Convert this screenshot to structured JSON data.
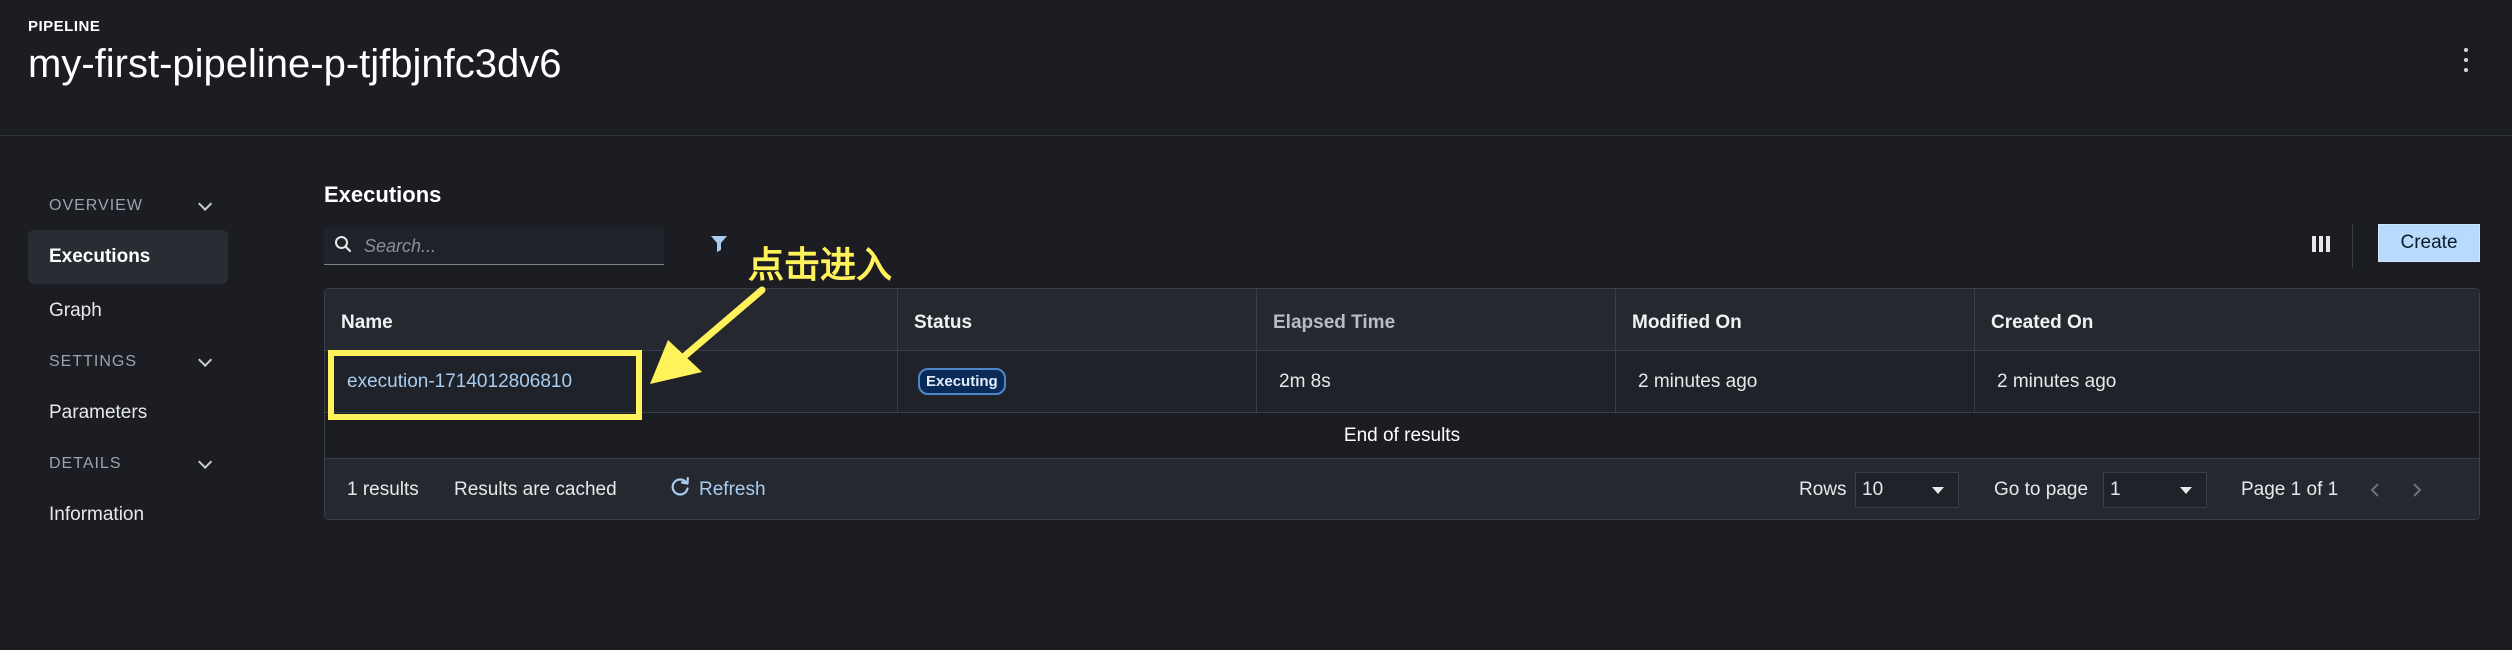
{
  "header": {
    "eyebrow": "PIPELINE",
    "title": "my-first-pipeline-p-tjfbjnfc3dv6",
    "menu_icon": "kebab-menu-icon"
  },
  "sidebar": {
    "items": [
      {
        "type": "section",
        "label": "OVERVIEW",
        "icon": "chevron-down-icon"
      },
      {
        "type": "item",
        "label": "Executions",
        "active": true
      },
      {
        "type": "item",
        "label": "Graph"
      },
      {
        "type": "section",
        "label": "SETTINGS",
        "icon": "chevron-down-icon"
      },
      {
        "type": "item",
        "label": "Parameters"
      },
      {
        "type": "section",
        "label": "DETAILS",
        "icon": "chevron-down-icon"
      },
      {
        "type": "item",
        "label": "Information"
      }
    ]
  },
  "main": {
    "section_title": "Executions",
    "search": {
      "placeholder": "Search...",
      "value": "",
      "icon": "search-icon"
    },
    "filter_icon": "filter-icon",
    "columns_icon": "columns-icon",
    "create_label": "Create",
    "table": {
      "columns": [
        "Name",
        "Status",
        "Elapsed Time",
        "Modified On",
        "Created On"
      ],
      "rows": [
        {
          "name": "execution-1714012806810",
          "status": "Executing",
          "elapsed": "2m 8s",
          "modified": "2 minutes ago",
          "created": "2 minutes ago"
        }
      ],
      "end_text": "End of results"
    },
    "footer": {
      "count": "1 results",
      "cached": "Results are cached",
      "refresh_label": "Refresh",
      "refresh_icon": "refresh-icon",
      "rows_label": "Rows",
      "rows_value": "10",
      "goto_label": "Go to page",
      "goto_value": "1",
      "page_info": "Page 1 of 1",
      "prev_icon": "chevron-left-icon",
      "next_icon": "chevron-right-icon"
    }
  },
  "annotation": {
    "text": "点击进入",
    "color": "#fff25a"
  },
  "colors": {
    "background": "#1b1d22",
    "accent_button": "#b8dafc",
    "link": "#a8cdf2",
    "status_badge_bg": "#0a2a57",
    "annotation": "#fff25a"
  }
}
